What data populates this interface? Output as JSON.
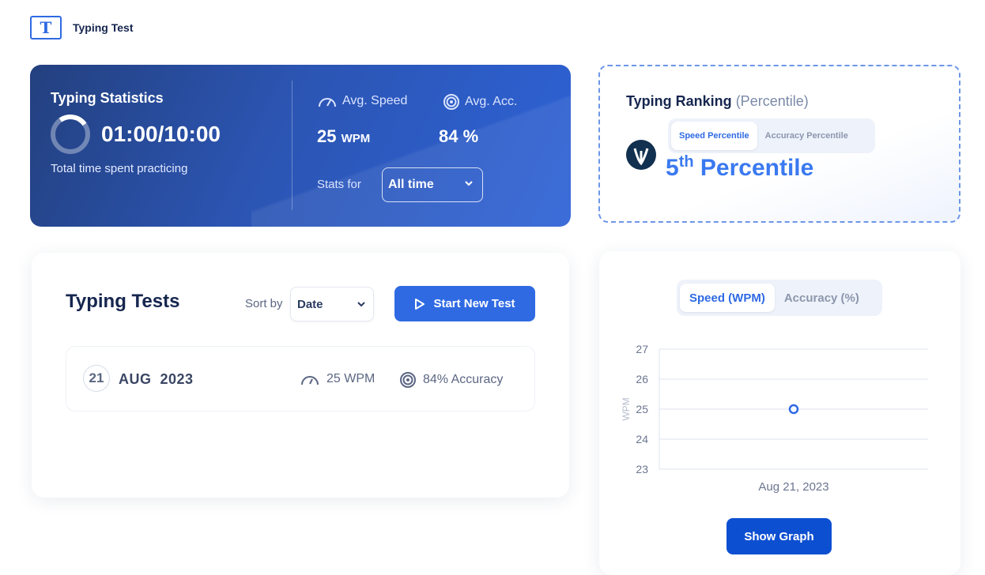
{
  "app": {
    "logo_letter": "T",
    "title": "Typing Test"
  },
  "stats": {
    "title": "Typing Statistics",
    "time_practiced": "01:00/10:00",
    "time_fraction": 0.1,
    "time_caption": "Total time spent practicing",
    "avg_speed_label": "Avg. Speed",
    "avg_speed_value": "25",
    "avg_speed_unit": "WPM",
    "avg_acc_label": "Avg. Acc.",
    "avg_acc_value": "84 %",
    "stats_for_label": "Stats for",
    "stats_for_selected": "All time"
  },
  "ranking": {
    "title": "Typing Ranking",
    "subtitle": "(Percentile)",
    "tabs": [
      {
        "label": "Speed Percentile",
        "active": true
      },
      {
        "label": "Accuracy Percentile",
        "active": false
      }
    ],
    "percentile_number": "5",
    "percentile_suffix": "th",
    "percentile_label": "Percentile"
  },
  "tests": {
    "title": "Typing Tests",
    "sort_label": "Sort by",
    "sort_selected": "Date",
    "start_button": "Start New Test",
    "rows": [
      {
        "day": "21",
        "month_year": "AUG  2023",
        "speed": "25 WPM",
        "accuracy": "84% Accuracy"
      }
    ]
  },
  "graph": {
    "tabs": [
      {
        "label": "Speed (WPM)",
        "active": true
      },
      {
        "label": "Accuracy (%)",
        "active": false
      }
    ],
    "show_graph_button": "Show Graph"
  },
  "chart_data": {
    "type": "scatter",
    "x": [
      "Aug 21, 2023"
    ],
    "y": [
      25
    ],
    "ylabel": "WPM",
    "xlabel": "",
    "yticks": [
      23,
      24,
      25,
      26,
      27
    ],
    "ylim": [
      23,
      27
    ],
    "grid": true,
    "point_color": "#2f6ae3"
  },
  "colors": {
    "accent": "#2f6ae3",
    "dark_button": "#0d4fd1",
    "heading": "#16264f"
  },
  "icons": {
    "speed": "speedometer-icon",
    "accuracy": "target-icon",
    "play": "play-icon",
    "chevron": "chevron-down-icon"
  }
}
